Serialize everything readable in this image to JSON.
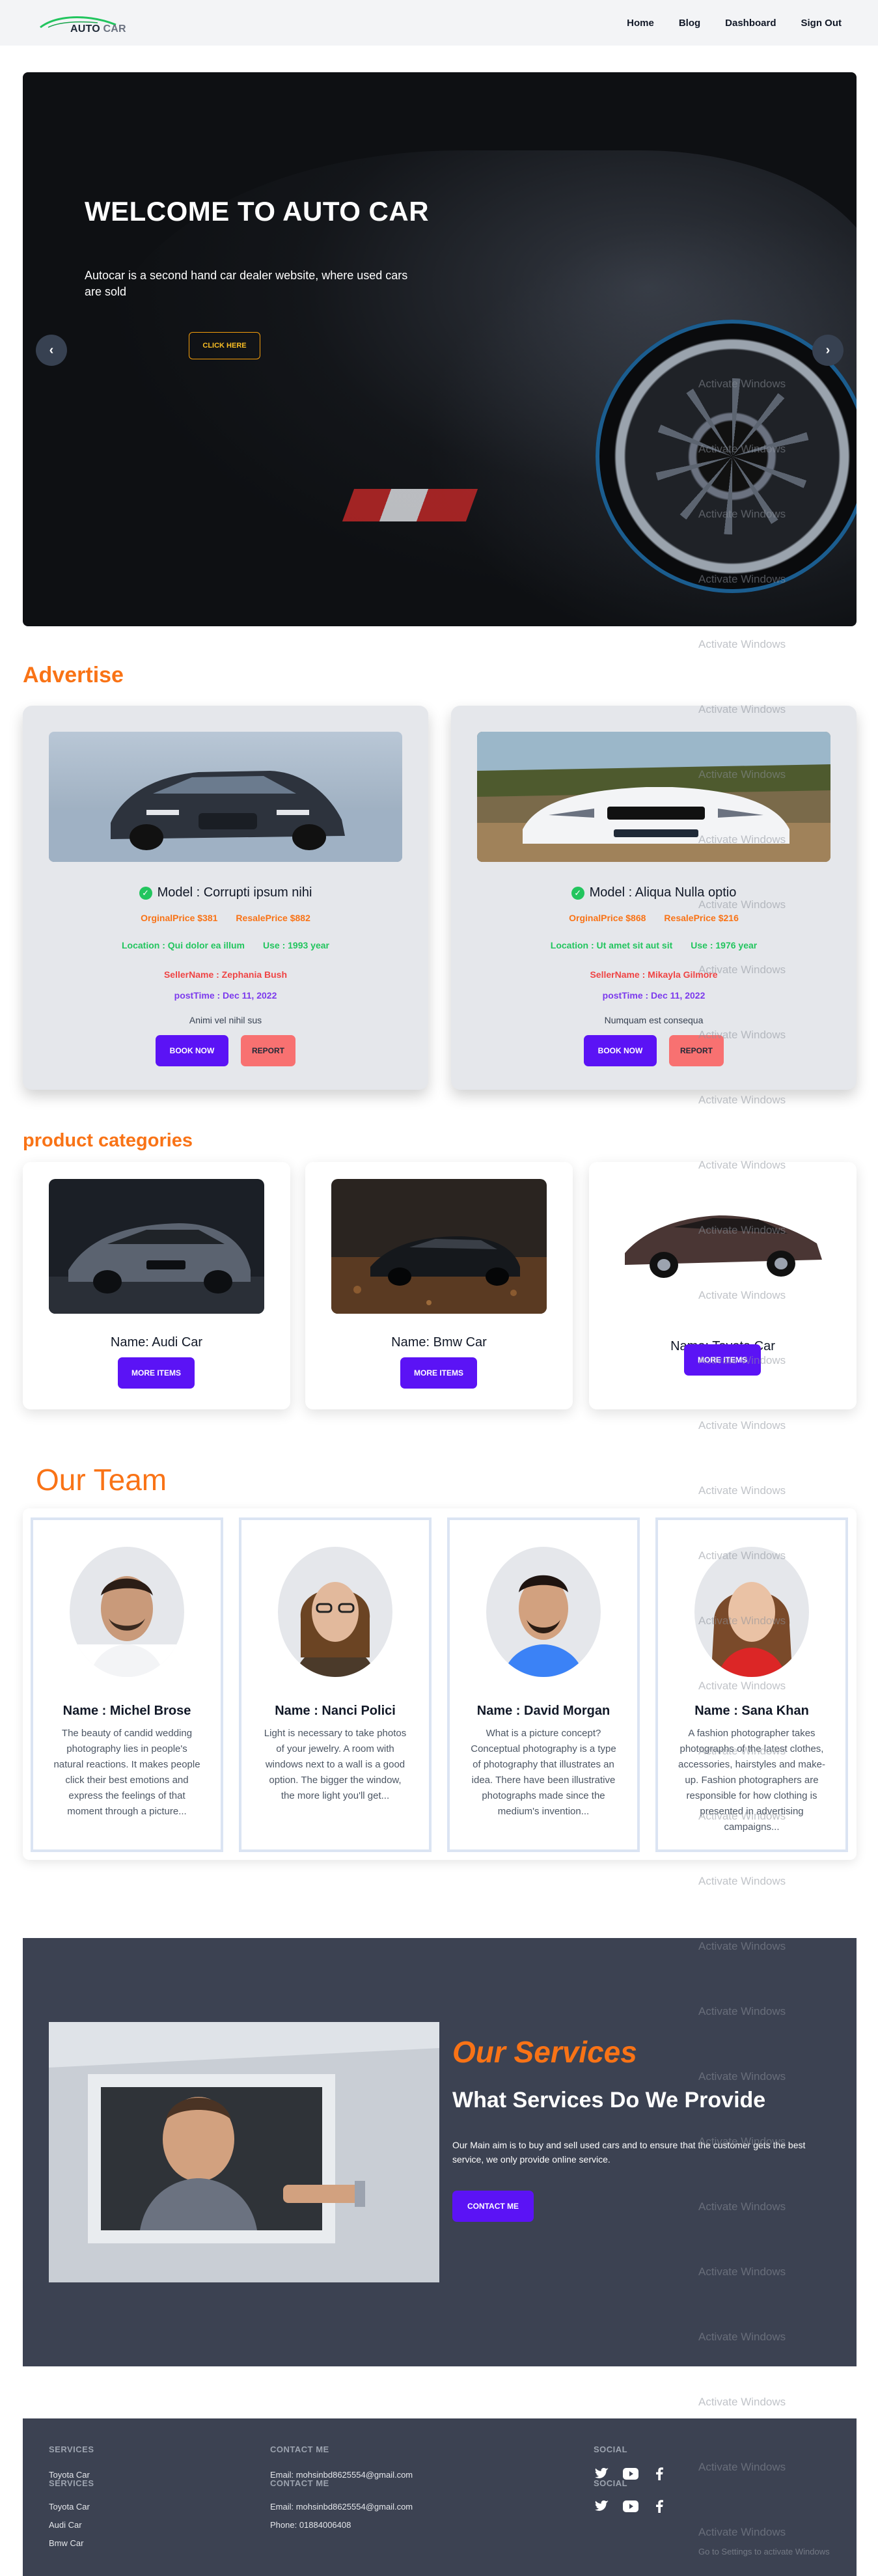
{
  "nav": {
    "logo_a": "AUTO",
    "logo_b": "CAR",
    "links": [
      "Home",
      "Blog",
      "Dashboard",
      "Sign Out"
    ]
  },
  "hero": {
    "title": "WELCOME TO AUTO CAR",
    "subtitle": "Autocar is a second hand car dealer website, where used cars are sold",
    "button": "CLICK HERE",
    "prev": "‹",
    "next": "›"
  },
  "advertise": {
    "title": "Advertise",
    "cards": [
      {
        "model": "Model : Corrupti ipsum nihi",
        "original_price": "OrginalPrice $381",
        "resale_price": "ResalePrice $882",
        "location": "Location : Qui dolor ea illum",
        "use": "Use : 1993 year",
        "seller": "SellerName : Zephania Bush",
        "post_time": "postTime : Dec 11, 2022",
        "description": "Animi vel nihil sus",
        "book": "BOOK NOW",
        "report": "REPORT"
      },
      {
        "model": "Model : Aliqua Nulla optio",
        "original_price": "OrginalPrice $868",
        "resale_price": "ResalePrice $216",
        "location": "Location : Ut amet sit aut sit",
        "use": "Use : 1976 year",
        "seller": "SellerName : Mikayla Gilmore",
        "post_time": "postTime : Dec 11, 2022",
        "description": "Numquam est consequa",
        "book": "BOOK NOW",
        "report": "REPORT"
      }
    ]
  },
  "categories": {
    "title": "product categories",
    "items": [
      {
        "name": "Name: Audi Car",
        "button": "MORE ITEMS"
      },
      {
        "name": "Name: Bmw Car",
        "button": "MORE ITEMS"
      },
      {
        "name": "Name: Toyota Car",
        "button": "MORE ITEMS"
      }
    ]
  },
  "team": {
    "title": "Our Team",
    "members": [
      {
        "name": "Name : Michel Brose",
        "bio": "The beauty of candid wedding photography lies in people's natural reactions. It makes people click their best emotions and express the feelings of that moment through a picture..."
      },
      {
        "name": "Name : Nanci Polici",
        "bio": "Light is necessary to take photos of your jewelry. A room with windows next to a wall is a good option. The bigger the window, the more light you'll get..."
      },
      {
        "name": "Name : David Morgan",
        "bio": "What is a picture concept? Conceptual photography is a type of photography that illustrates an idea. There have been illustrative photographs made since the medium's invention..."
      },
      {
        "name": "Name : Sana Khan",
        "bio": "A fashion photographer takes photographs of the latest clothes, accessories, hairstyles and make-up. Fashion photographers are responsible for how clothing is presented in advertising campaigns..."
      }
    ]
  },
  "services": {
    "heading": "Our Services",
    "subheading": "What Services Do We Provide",
    "text": "Our Main aim is to buy and sell used cars and to ensure that the customer gets the best service, we only provide online service.",
    "button": "CONTACT ME"
  },
  "footer": {
    "services_head": "SERVICES",
    "services_head2": "SERVICES",
    "services_items_top": [
      "Toyota Car"
    ],
    "services_items": [
      "Toyota Car",
      "Audi Car",
      "Bmw Car"
    ],
    "contact_head": "CONTACT ME",
    "contact_head2": "CONTACT ME",
    "email_top": "Email: mohsinbd8625554@gmail.com",
    "email": "Email: mohsinbd8625554@gmail.com",
    "phone": "Phone: 01884006408",
    "social_head": "SOCIAL",
    "social_head2": "SOCIAL",
    "social_icons": [
      "twitter-icon",
      "youtube-icon",
      "facebook-icon"
    ]
  },
  "watermark": {
    "text": "Activate Windows",
    "hint": "Go to Settings to activate Windows"
  },
  "colors": {
    "accent": "#f97316",
    "primary_button": "#5b13f5",
    "report_button": "#f87171",
    "dark_section": "#3c4252"
  }
}
